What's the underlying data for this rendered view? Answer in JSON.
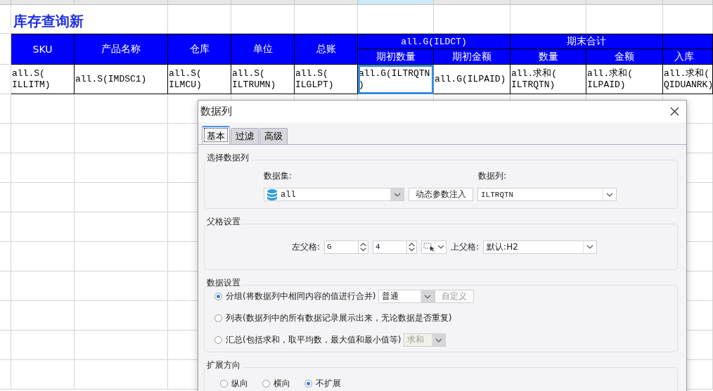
{
  "sheet": {
    "title": "库存查询新",
    "headers": [
      {
        "kind": "single",
        "label": "SKU"
      },
      {
        "kind": "single",
        "label": "产品名称"
      },
      {
        "kind": "single",
        "label": "仓库"
      },
      {
        "kind": "single",
        "label": "单位"
      },
      {
        "kind": "single",
        "label": "总账"
      },
      {
        "kind": "group",
        "label": "all.G(ILDCT)",
        "sub": [
          "期初数量",
          "期初金额"
        ]
      },
      {
        "kind": "group",
        "label": "期末合计",
        "sub": [
          "数量",
          "金额"
        ]
      },
      {
        "kind": "group",
        "sub": [
          "入库"
        ]
      }
    ],
    "cells": [
      {
        "text": "all.S(\nILLITM)",
        "selected": false
      },
      {
        "text": "all.S(IMDSC1)",
        "selected": false
      },
      {
        "text": "all.S(\nILMCU)",
        "selected": false
      },
      {
        "text": "all.S(\nILTRUMN)",
        "selected": false
      },
      {
        "text": "all.S(\nILGLPT)",
        "selected": false
      },
      {
        "text": "all.G(ILTRQTN\n)",
        "selected": true
      },
      {
        "text": "all.G(ILPAID)",
        "selected": false
      },
      {
        "text": "all.求和(\nILTRQTN)",
        "selected": false
      },
      {
        "text": "all.求和(\nILPAID)",
        "selected": false
      },
      {
        "text": "all.求和(\nQIDUANRK)",
        "selected": false
      }
    ]
  },
  "dialog": {
    "title": "数据列",
    "tabs": [
      {
        "label": "基本",
        "selected": true
      },
      {
        "label": "过滤",
        "selected": false
      },
      {
        "label": "高级",
        "selected": false
      }
    ],
    "select_column": {
      "title": "选择数据列",
      "dataset_label": "数据集:",
      "dataset_value": "all",
      "inject_button": "动态参数注入",
      "column_label": "数据列:",
      "column_value": "ILTRQTN"
    },
    "parent": {
      "title": "父格设置",
      "left_label": "左父格:",
      "left_column": "G",
      "left_row": "4",
      "top_label": "上父格:",
      "top_value": "默认:H2"
    },
    "data_settings": {
      "title": "数据设置",
      "options": [
        {
          "kind": "group",
          "label": "分组(将数据列中相同内容的值进行合并)",
          "selected": true,
          "mode": "普通",
          "custom_button": "自定义",
          "custom_disabled": true
        },
        {
          "kind": "list",
          "label": "列表(数据列中的所有数据记录展示出来，无论数据是否重复)",
          "selected": false
        },
        {
          "kind": "summary",
          "label": "汇总(包括求和，取平均数，最大值和最小值等)",
          "selected": false,
          "function": "求和",
          "function_disabled": true
        }
      ]
    },
    "expand": {
      "title": "扩展方向",
      "options": [
        {
          "label": "纵向",
          "selected": false
        },
        {
          "label": "横向",
          "selected": false
        },
        {
          "label": "不扩展",
          "selected": true
        }
      ]
    }
  }
}
